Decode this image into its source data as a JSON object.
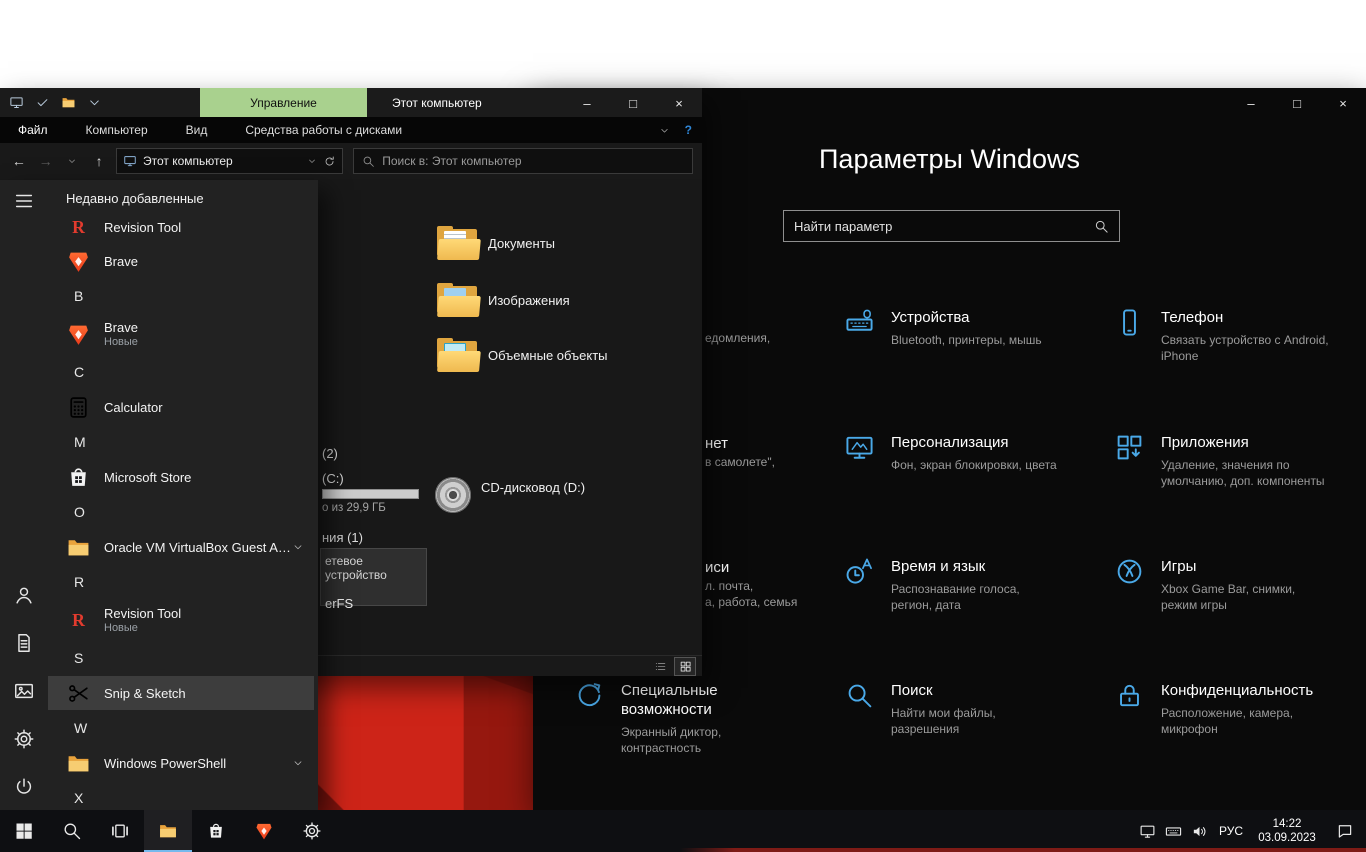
{
  "window_controls": {
    "minimize": "–",
    "maximize": "□",
    "close": "×"
  },
  "colors": {
    "settings_icon": "#4aa9e8",
    "management_tab": "#a9d18e",
    "taskbar_active_underline": "#76b9ed",
    "wallpaper_accent": "#cd2418"
  },
  "explorer": {
    "window_title": "Этот компьютер",
    "contextual_tab": "Управление",
    "menu_tabs": [
      "Файл",
      "Компьютер",
      "Вид",
      "Средства работы с дисками"
    ],
    "help_label": "?",
    "address": "Этот компьютер",
    "search_placeholder": "Поиск в: Этот компьютер",
    "quick_access": [
      {
        "icon": "pc",
        "name": "quick-access-this-pc"
      },
      {
        "icon": "check",
        "name": "quick-access-check"
      },
      {
        "icon": "folder-small",
        "name": "quick-access-folder"
      },
      {
        "icon": "chevron-down",
        "name": "quick-access-dropdown"
      }
    ],
    "folders": [
      {
        "label": "Документы",
        "variant": "doc"
      },
      {
        "label": "Изображения",
        "variant": "pic"
      },
      {
        "label": "Объемные объекты",
        "variant": "obj"
      }
    ],
    "drives_group_fragment": "(2)",
    "drive_c_fragment": "(C:)",
    "drive_c_capacity_fragment": "о из 29,9 ГБ",
    "cd_drive_label": "CD-дисковод (D:)",
    "network_group_fragment": "ния (1)",
    "network_tooltip_line1": "етевое устройство",
    "network_tooltip_line2": "erFS"
  },
  "start_menu": {
    "recent_header": "Недавно добавленные",
    "rail": [
      {
        "icon": "hamburger",
        "name": "start-expand-button"
      },
      {
        "icon": "person",
        "name": "start-account-button"
      },
      {
        "icon": "document",
        "name": "start-documents-button"
      },
      {
        "icon": "picture",
        "name": "start-pictures-button"
      },
      {
        "icon": "gear",
        "name": "start-settings-button"
      },
      {
        "icon": "power",
        "name": "start-power-button"
      }
    ],
    "items": [
      {
        "type": "app",
        "icon": "revision",
        "label": "Revision Tool"
      },
      {
        "type": "app",
        "icon": "brave",
        "label": "Brave"
      },
      {
        "type": "letter",
        "label": "B"
      },
      {
        "type": "app",
        "icon": "brave",
        "label": "Brave",
        "badge": "Новые"
      },
      {
        "type": "letter",
        "label": "C"
      },
      {
        "type": "app",
        "icon": "calculator",
        "label": "Calculator"
      },
      {
        "type": "letter",
        "label": "M"
      },
      {
        "type": "app",
        "icon": "store",
        "label": "Microsoft Store"
      },
      {
        "type": "letter",
        "label": "O"
      },
      {
        "type": "app",
        "icon": "folder-small",
        "label": "Oracle VM VirtualBox Guest Addit...",
        "chevron": true
      },
      {
        "type": "letter",
        "label": "R"
      },
      {
        "type": "app",
        "icon": "revision",
        "label": "Revision Tool",
        "badge": "Новые"
      },
      {
        "type": "letter",
        "label": "S"
      },
      {
        "type": "app",
        "icon": "snip",
        "label": "Snip & Sketch",
        "selected": true
      },
      {
        "type": "letter",
        "label": "W"
      },
      {
        "type": "app",
        "icon": "folder-small",
        "label": "Windows PowerShell",
        "chevron": true
      },
      {
        "type": "letter",
        "label": "X"
      }
    ]
  },
  "settings": {
    "title": "Параметры Windows",
    "search_placeholder": "Найти параметр",
    "grid": [
      {
        "icon": "devices",
        "title": "Устройства",
        "subtitle": "Bluetooth, принтеры, мышь",
        "col": 2,
        "row": 1
      },
      {
        "icon": "phone",
        "title": "Телефон",
        "subtitle": "Связать устройство с Android, iPhone",
        "col": 3,
        "row": 1
      },
      {
        "icon": "personalization",
        "title": "Персонализация",
        "subtitle": "Фон, экран блокировки, цвета",
        "col": 2,
        "row": 2
      },
      {
        "icon": "apps",
        "title": "Приложения",
        "subtitle": "Удаление, значения по умолчанию, доп. компоненты",
        "col": 3,
        "row": 2
      },
      {
        "icon": "time-language",
        "title": "Время и язык",
        "subtitle": "Распознавание голоса, регион, дата",
        "col": 2,
        "row": 3
      },
      {
        "icon": "gaming",
        "title": "Игры",
        "subtitle": "Xbox Game Bar, снимки, режим игры",
        "col": 3,
        "row": 3
      },
      {
        "icon": "accessibility",
        "title": "Специальные возможности",
        "subtitle": "Экранный диктор, контрастность",
        "col": 1,
        "row": 4
      },
      {
        "icon": "search",
        "title": "Поиск",
        "subtitle": "Найти мои файлы, разрешения",
        "col": 2,
        "row": 4
      },
      {
        "icon": "privacy",
        "title": "Конфиденциальность",
        "subtitle": "Расположение, камера, микрофон",
        "col": 3,
        "row": 4
      }
    ],
    "occluded_fragments": [
      {
        "lines": [
          {
            "kind": "subtitle",
            "text": "едомления,"
          }
        ]
      },
      {
        "lines": [
          {
            "kind": "title",
            "text": "нет"
          },
          {
            "kind": "subtitle",
            "text": "в самолете\","
          }
        ]
      },
      {
        "lines": [
          {
            "kind": "title",
            "text": "иси"
          },
          {
            "kind": "subtitle",
            "text": "л. почта,"
          },
          {
            "kind": "subtitle",
            "text": "а, работа, семья"
          }
        ]
      }
    ]
  },
  "taskbar": {
    "buttons": [
      {
        "icon": "win-logo",
        "name": "start-button"
      },
      {
        "icon": "search",
        "name": "taskbar-search-button"
      },
      {
        "icon": "task-view",
        "name": "task-view-button"
      },
      {
        "icon": "explorer-folder",
        "name": "taskbar-explorer-button",
        "active": true
      },
      {
        "icon": "store",
        "name": "taskbar-store-button"
      },
      {
        "icon": "brave",
        "name": "taskbar-brave-button"
      },
      {
        "icon": "gear",
        "name": "taskbar-settings-button"
      }
    ],
    "tray_icons": [
      {
        "icon": "network",
        "name": "tray-network-icon"
      },
      {
        "icon": "keyboard",
        "name": "tray-keyboard-icon"
      },
      {
        "icon": "speaker",
        "name": "tray-speaker-icon"
      }
    ],
    "language": "РУС",
    "time": "14:22",
    "date": "03.09.2023"
  }
}
